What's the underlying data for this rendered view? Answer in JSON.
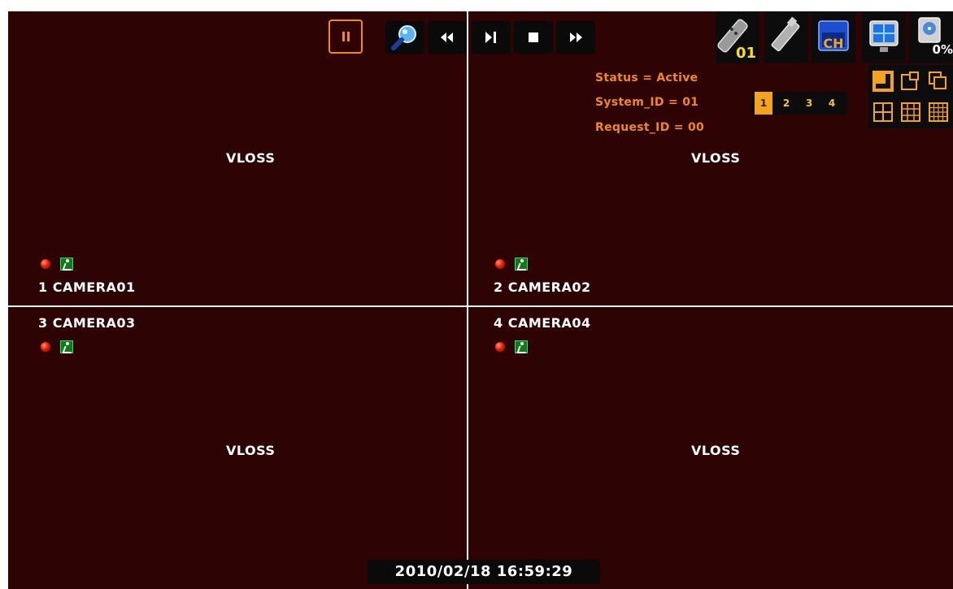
{
  "cameras": [
    {
      "label": "1 CAMERA01",
      "video": "VLOSS"
    },
    {
      "label": "2 CAMERA02",
      "video": "VLOSS"
    },
    {
      "label": "3 CAMERA03",
      "video": "VLOSS"
    },
    {
      "label": "4 CAMERA04",
      "video": "VLOSS"
    }
  ],
  "status": {
    "status": "Status = Active",
    "system_id": "System_ID = 01",
    "request_id": "Request_ID = 00"
  },
  "page_selector": [
    "1",
    "2",
    "3",
    "4"
  ],
  "active_page": "1",
  "status_icons": {
    "remote_id": "01",
    "channel": "CH",
    "disk_usage": "0%"
  },
  "toolbar": [
    "pause",
    "zoom",
    "rewind",
    "play-pause",
    "stop",
    "fast-forward"
  ],
  "datetime": "2010/02/18 16:59:29",
  "colors": {
    "background": "#2e0303",
    "accent": "#f08a1c",
    "active_page": "#f5a21c"
  }
}
